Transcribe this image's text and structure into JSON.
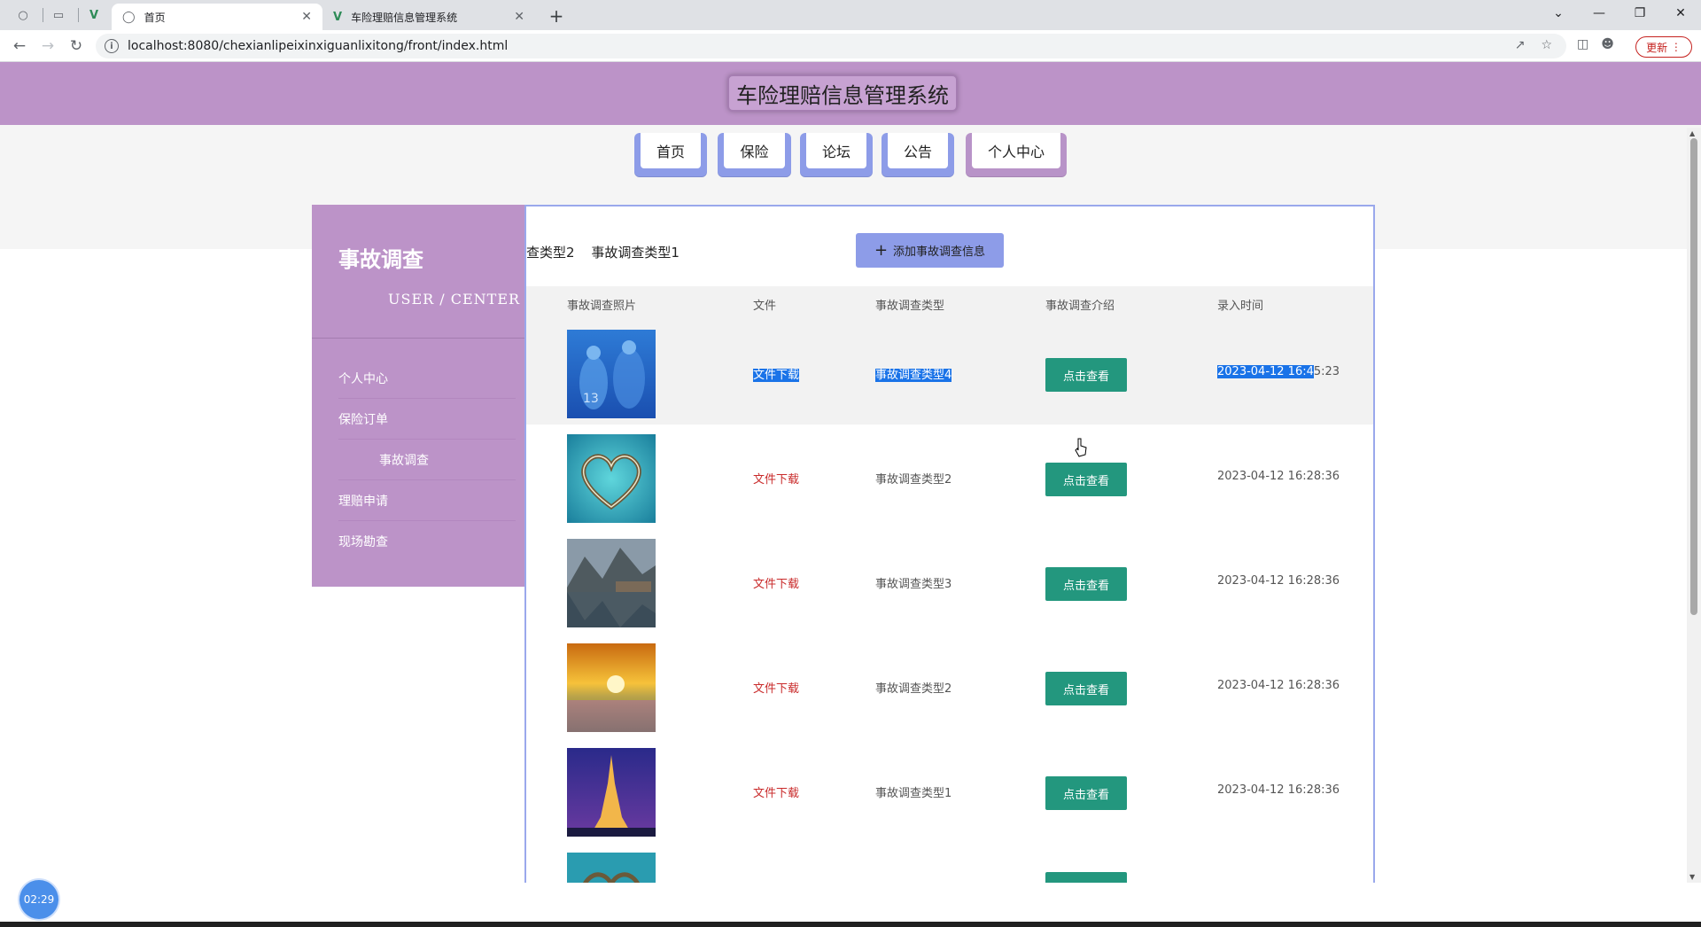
{
  "browser": {
    "tabs": [
      {
        "title": "首页",
        "active": true,
        "icon": "globe-icon"
      },
      {
        "title": "车险理赔信息管理系统",
        "active": false,
        "icon": "vue-logo-icon"
      }
    ],
    "url": "localhost:8080/chexianlipeixinxiguanlixitong/front/index.html",
    "update_label": "更新"
  },
  "site": {
    "title": "车险理赔信息管理系统",
    "nav": [
      {
        "label": "首页",
        "current": false
      },
      {
        "label": "保险",
        "current": false
      },
      {
        "label": "论坛",
        "current": false
      },
      {
        "label": "公告",
        "current": false
      },
      {
        "label": "个人中心",
        "current": true
      }
    ]
  },
  "sidebar": {
    "title": "事故调查",
    "subtitle": "USER / CENTER",
    "items": [
      {
        "label": "个人中心",
        "active": false
      },
      {
        "label": "保险订单",
        "active": false
      },
      {
        "label": "事故调查",
        "active": true
      },
      {
        "label": "理赔申请",
        "active": false
      },
      {
        "label": "现场勘查",
        "active": false
      }
    ]
  },
  "main": {
    "type_tabs": [
      "查类型2",
      "事故调查类型1"
    ],
    "add_button": "添加事故调查信息",
    "columns": [
      "事故调查照片",
      "文件",
      "事故调查类型",
      "事故调查介绍",
      "录入时间"
    ],
    "rows": [
      {
        "file": "文件下载",
        "type": "事故调查类型4",
        "action": "点击查看",
        "time_selected": "2023-04-12 16:4",
        "time_rest": "5:23",
        "photo": "blue-team-photo"
      },
      {
        "file": "文件下载",
        "type": "事故调查类型2",
        "action": "点击查看",
        "time": "2023-04-12 16:28:36",
        "photo": "heart-island-photo"
      },
      {
        "file": "文件下载",
        "type": "事故调查类型3",
        "action": "点击查看",
        "time": "2023-04-12 16:28:36",
        "photo": "lake-village-photo"
      },
      {
        "file": "文件下载",
        "type": "事故调查类型2",
        "action": "点击查看",
        "time": "2023-04-12 16:28:36",
        "photo": "sunset-meadow-photo"
      },
      {
        "file": "文件下载",
        "type": "事故调查类型1",
        "action": "点击查看",
        "time": "2023-04-12 16:28:36",
        "photo": "eiffel-tower-photo"
      }
    ]
  },
  "timer": "02:29",
  "colors": {
    "header_purple": "#bc93c8",
    "nav_blue": "#8d9ce8",
    "view_button_green": "#23977e",
    "file_link_red": "#c92b2b"
  }
}
